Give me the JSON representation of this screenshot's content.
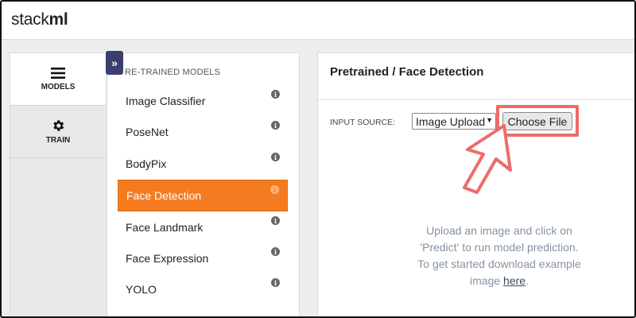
{
  "app": {
    "logo_regular": "stack",
    "logo_bold": "ml"
  },
  "rail": {
    "items": [
      {
        "label": "MODELS",
        "icon": "hamburger-menu-icon",
        "active": true
      },
      {
        "label": "TRAIN",
        "icon": "gear-icon",
        "active": false
      }
    ]
  },
  "models_panel": {
    "collapse_glyph": "»",
    "heading": "RE-TRAINED MODELS",
    "items": [
      {
        "label": "Image Classifier"
      },
      {
        "label": "PoseNet"
      },
      {
        "label": "BodyPix"
      },
      {
        "label": "Face Detection",
        "active": true
      },
      {
        "label": "Face Landmark"
      },
      {
        "label": "Face Expression"
      },
      {
        "label": "YOLO"
      }
    ],
    "info_glyph": "i"
  },
  "main": {
    "title": "Pretrained / Face Detection",
    "input_source_label": "INPUT SOURCE:",
    "input_source_value": "Image Upload",
    "choose_file_label": "Choose File",
    "upload_line1": "Upload an image and click on",
    "upload_line2": "'Predict' to run model prediction.",
    "upload_line3": "To get started download example",
    "upload_line4_prefix": "image ",
    "upload_link": "here",
    "upload_line4_suffix": "."
  },
  "colors": {
    "accent_orange": "#f47b20",
    "highlight_red": "#f06a6a",
    "rail_toggle": "#3b3f6e"
  }
}
